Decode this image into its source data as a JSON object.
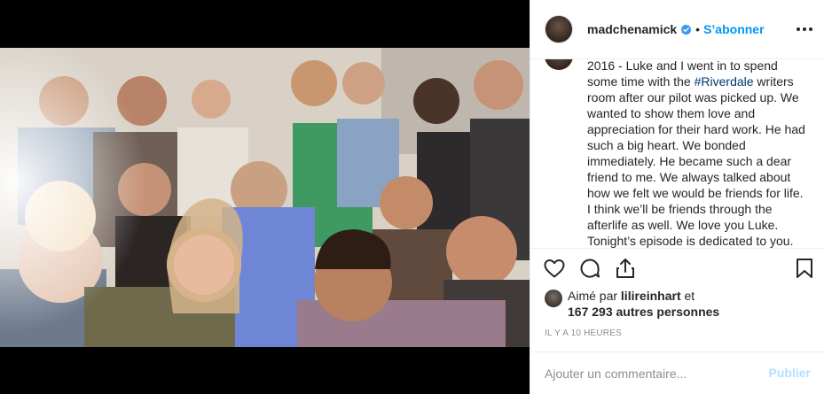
{
  "post": {
    "username": "madchenamick",
    "verified": true,
    "separator": "•",
    "follow_label": "S’abonner",
    "caption_part1": "2016 - Luke and I went in to spend some time with the ",
    "caption_hashtag": "#Riverdale",
    "caption_part2": " writers room after our pilot was picked up. We wanted to show them love and appreciation for their hard work. He had such a big heart. We bonded immediately. He became such a dear friend to me. We always talked about how we felt we would be friends for life. I think we’ll be friends through the afterlife as well. We love you Luke. Tonight’s episode is dedicated to you.",
    "liked_prefix": "Aimé par ",
    "liked_by": "lilireinhart",
    "liked_and": " et",
    "likes_count": "167 293 autres personnes",
    "timestamp": "IL Y A 10 HEURES"
  },
  "comment": {
    "placeholder": "Ajouter un commentaire...",
    "post_label": "Publier"
  },
  "icons": {
    "like": "heart-icon",
    "comment": "comment-icon",
    "share": "share-icon",
    "save": "bookmark-icon",
    "more": "more-options-icon",
    "verified": "verified-badge-icon"
  },
  "colors": {
    "follow": "#0095f6",
    "hashtag": "#00376b",
    "muted": "#8e8e8e",
    "post_disabled": "#b2dffc"
  }
}
